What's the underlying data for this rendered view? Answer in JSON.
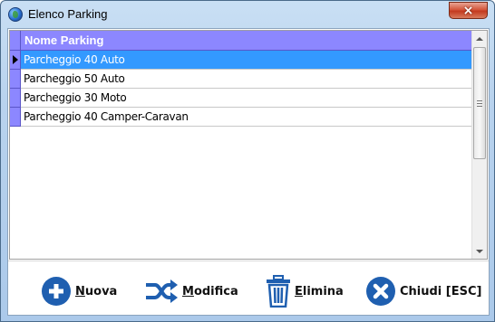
{
  "window": {
    "title": "Elenco Parking",
    "close_label": "×"
  },
  "grid": {
    "column_header": "Nome Parking",
    "rows": [
      {
        "name": "Parcheggio 40 Auto",
        "selected": true
      },
      {
        "name": "Parcheggio 50 Auto",
        "selected": false
      },
      {
        "name": "Parcheggio 30 Moto",
        "selected": false
      },
      {
        "name": "Parcheggio 40 Camper-Caravan",
        "selected": false
      }
    ]
  },
  "toolbar": {
    "new": {
      "underline": "N",
      "rest": "uova",
      "icon": "plus-circle-icon"
    },
    "edit": {
      "underline": "M",
      "rest": "odifica",
      "icon": "shuffle-icon"
    },
    "delete": {
      "underline": "E",
      "rest": "limina",
      "icon": "trash-icon"
    },
    "close": {
      "label": "Chiudi [ESC]",
      "icon": "close-circle-icon"
    }
  },
  "colors": {
    "header_bg": "#8c87ff",
    "selection": "#3399ff",
    "icon_blue": "#1f5fb0"
  }
}
